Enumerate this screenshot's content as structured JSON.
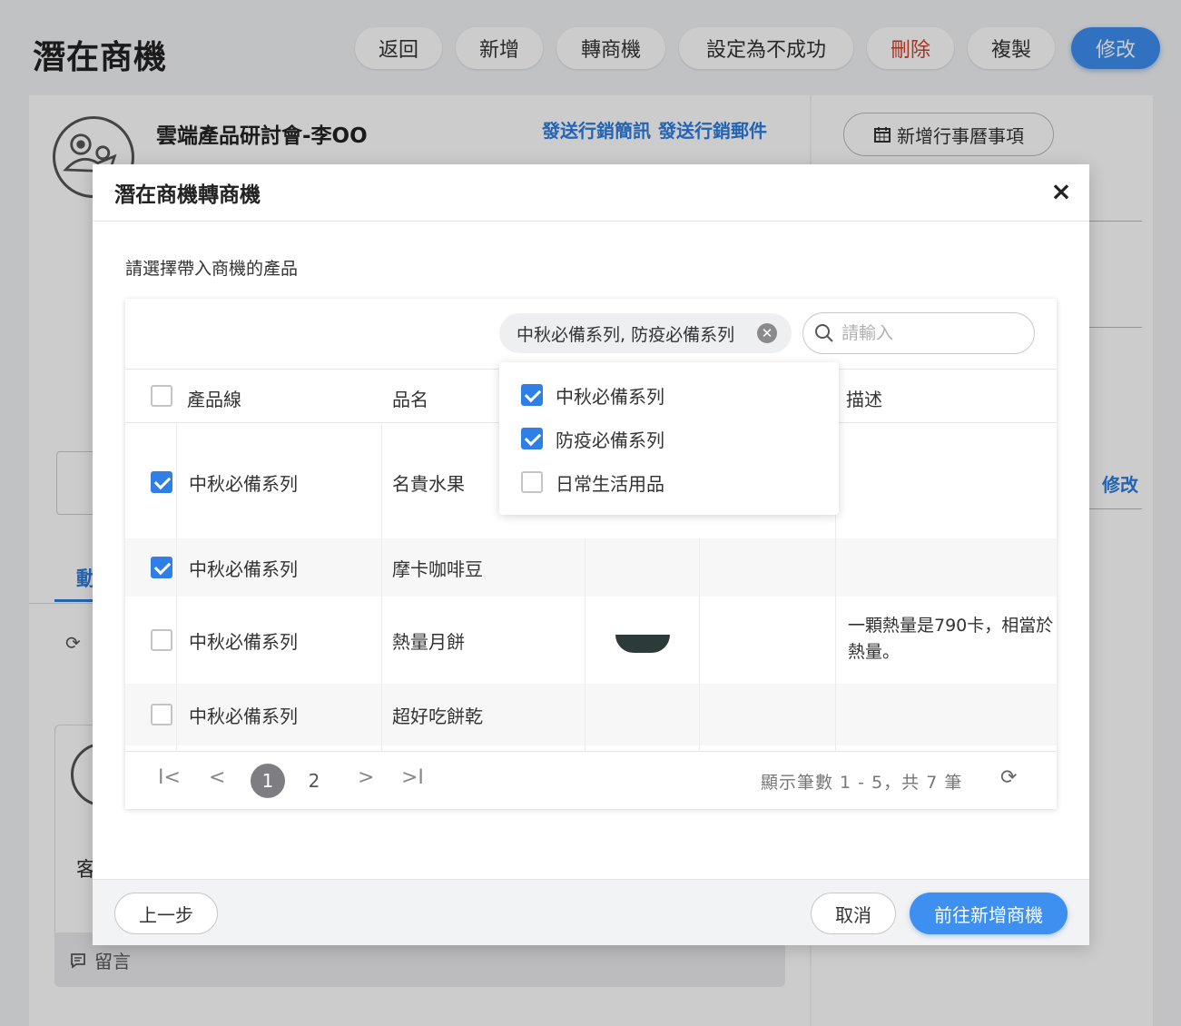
{
  "header": {
    "title": "潛在商機",
    "buttons": {
      "back": "返回",
      "add": "新增",
      "convert": "轉商機",
      "set_failed": "設定為不成功",
      "delete": "刪除",
      "copy": "複製",
      "edit": "修改"
    }
  },
  "lead": {
    "name": "雲端產品研討會-李OO",
    "send_sms": "發送行銷簡訊",
    "send_email": "發送行銷郵件",
    "add_calendar": "新增行事曆事項",
    "side_edit": "修改",
    "tab_partial": "動",
    "customer_partial": "客",
    "comment": "留言"
  },
  "modal": {
    "title": "潛在商機轉商機",
    "close": "×",
    "subtitle": "請選擇帶入商機的產品",
    "filter_chip": "中秋必備系列, 防疫必備系列",
    "search_placeholder": "請輸入",
    "columns": {
      "product_line": "產品線",
      "name": "品名",
      "description": "描述"
    },
    "rows": [
      {
        "product_line": "中秋必備系列",
        "name": "名貴水果",
        "description": "",
        "checked": true
      },
      {
        "product_line": "中秋必備系列",
        "name": "摩卡咖啡豆",
        "description": "",
        "checked": true
      },
      {
        "product_line": "中秋必備系列",
        "name": "熱量月餅",
        "description_line1": "一顆熱量是790卡，相當於",
        "description_line2": "熱量。",
        "checked": false
      },
      {
        "product_line": "中秋必備系列",
        "name": "超好吃餅乾",
        "description": "",
        "checked": false
      }
    ],
    "dropdown": [
      {
        "label": "中秋必備系列",
        "checked": true
      },
      {
        "label": "防疫必備系列",
        "checked": true
      },
      {
        "label": "日常生活用品",
        "checked": false
      }
    ],
    "pager": {
      "first": "I<",
      "prev": "<",
      "pages": [
        "1",
        "2"
      ],
      "current": "1",
      "next": ">",
      "last": ">I",
      "info": "顯示筆數 1 - 5，共 7 筆",
      "refresh": "⟳"
    },
    "footer": {
      "prev_step": "上一步",
      "cancel": "取消",
      "proceed": "前往新增商機"
    }
  },
  "colors": {
    "primary": "#3d8ff0",
    "link": "#2d7ee0",
    "danger": "#d0402b",
    "checkbox": "#2f7fe6"
  },
  "icons": [
    "close-icon",
    "search-icon",
    "calendar-icon",
    "refresh-icon",
    "comment-icon",
    "first-page-icon",
    "prev-page-icon",
    "next-page-icon",
    "last-page-icon",
    "clear-icon"
  ]
}
